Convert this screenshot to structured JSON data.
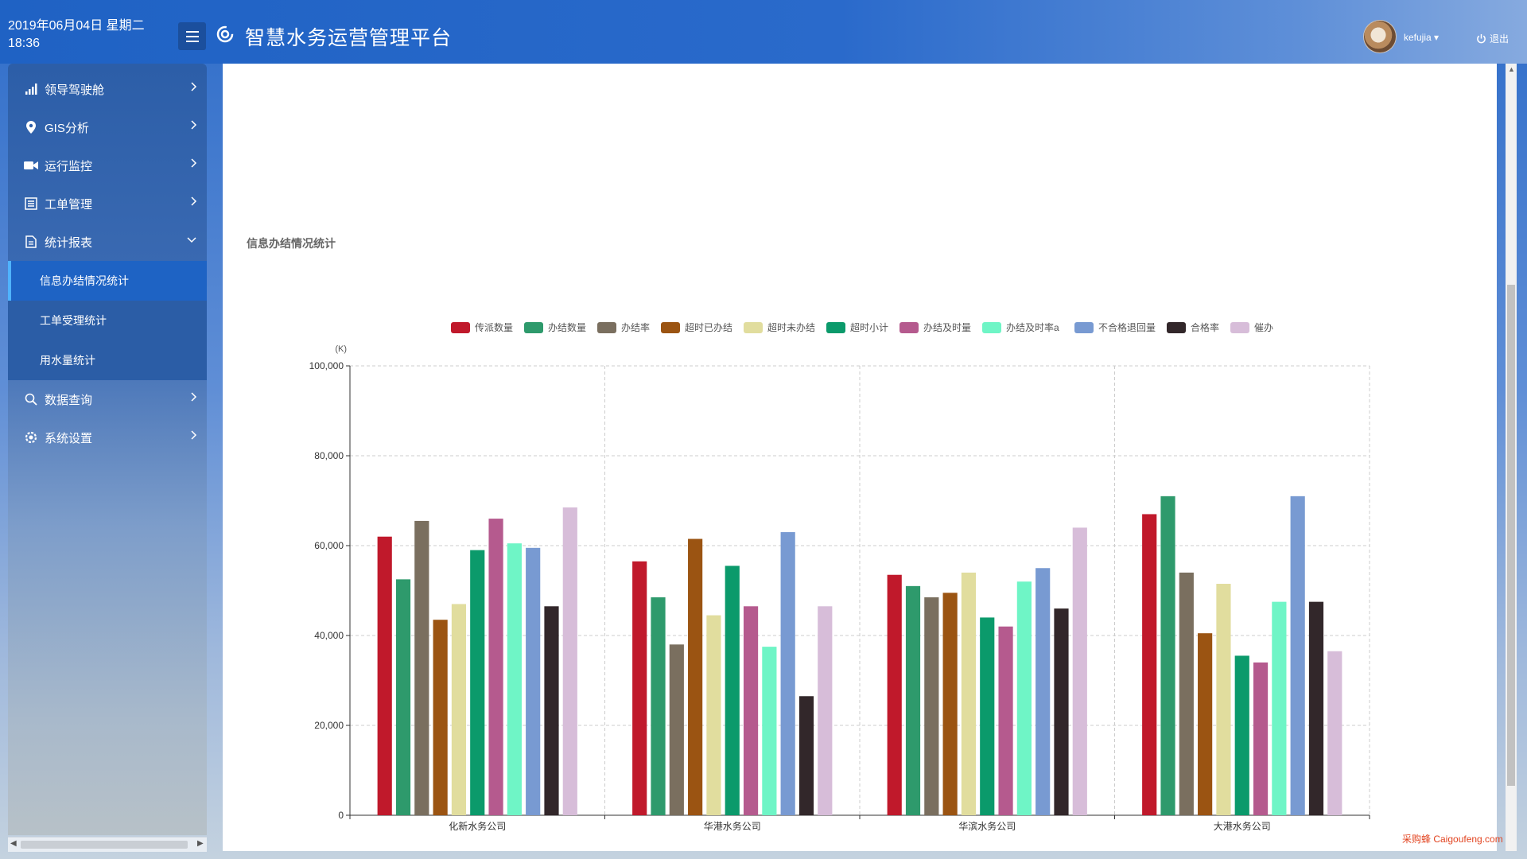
{
  "header": {
    "date": "2019年06月04日 星期二",
    "time": "18:36",
    "app_title": "智慧水务运营管理平台",
    "username": "kefujia",
    "logout_label": "退出"
  },
  "sidebar": {
    "items": [
      {
        "label": "领导驾驶舱",
        "icon": "signal-bars-icon"
      },
      {
        "label": "GIS分析",
        "icon": "map-pin-icon"
      },
      {
        "label": "运行监控",
        "icon": "video-camera-icon"
      },
      {
        "label": "工单管理",
        "icon": "list-icon"
      },
      {
        "label": "统计报表",
        "icon": "document-icon"
      }
    ],
    "sub_items": [
      {
        "label": "信息办结情况统计",
        "active": true
      },
      {
        "label": "工单受理统计",
        "active": false
      },
      {
        "label": "用水量统计",
        "active": false
      }
    ],
    "items_after": [
      {
        "label": "数据查询",
        "icon": "search-icon"
      },
      {
        "label": "系统设置",
        "icon": "gear-icon"
      }
    ]
  },
  "main": {
    "section_title": "信息办结情况统计"
  },
  "watermark": "采购蜂 Caigoufeng.com",
  "chart_data": {
    "type": "bar",
    "title": "",
    "ylabel": "(K)",
    "xlabel": "",
    "ylim": [
      0,
      100000
    ],
    "yticks": [
      "0",
      "20,000",
      "40,000",
      "60,000",
      "80,000",
      "100,000"
    ],
    "grid": true,
    "legend_position": "top-center",
    "categories": [
      "化新水务公司",
      "华港水务公司",
      "华滨水务公司",
      "大港水务公司"
    ],
    "series": [
      {
        "name": "传派数量",
        "color": "#c0192b",
        "values": [
          62000,
          56500,
          53500,
          67000
        ]
      },
      {
        "name": "办结数量",
        "color": "#2e9a6c",
        "values": [
          52500,
          48500,
          51000,
          71000
        ]
      },
      {
        "name": "办结率",
        "color": "#7a6f5f",
        "values": [
          65500,
          38000,
          48500,
          54000
        ]
      },
      {
        "name": "超时已办结",
        "color": "#9b5412",
        "values": [
          43500,
          61500,
          49500,
          40500
        ]
      },
      {
        "name": "超时未办结",
        "color": "#e1dd9e",
        "values": [
          47000,
          44500,
          54000,
          51500
        ]
      },
      {
        "name": "超时小计",
        "color": "#0b9a6b",
        "values": [
          59000,
          55500,
          44000,
          35500
        ]
      },
      {
        "name": "办结及时量",
        "color": "#b55a8e",
        "values": [
          66000,
          46500,
          42000,
          34000
        ]
      },
      {
        "name": "办结及时率a",
        "color": "#6ff5c6",
        "values": [
          60500,
          37500,
          52000,
          47500
        ]
      },
      {
        "name": "不合格退回量",
        "color": "#789ad2",
        "values": [
          59500,
          63000,
          55000,
          71000
        ]
      },
      {
        "name": "合格率",
        "color": "#32272a",
        "values": [
          46500,
          26500,
          46000,
          47500
        ]
      },
      {
        "name": "催办",
        "color": "#d7bdd9",
        "values": [
          68500,
          46500,
          64000,
          36500
        ]
      }
    ]
  }
}
